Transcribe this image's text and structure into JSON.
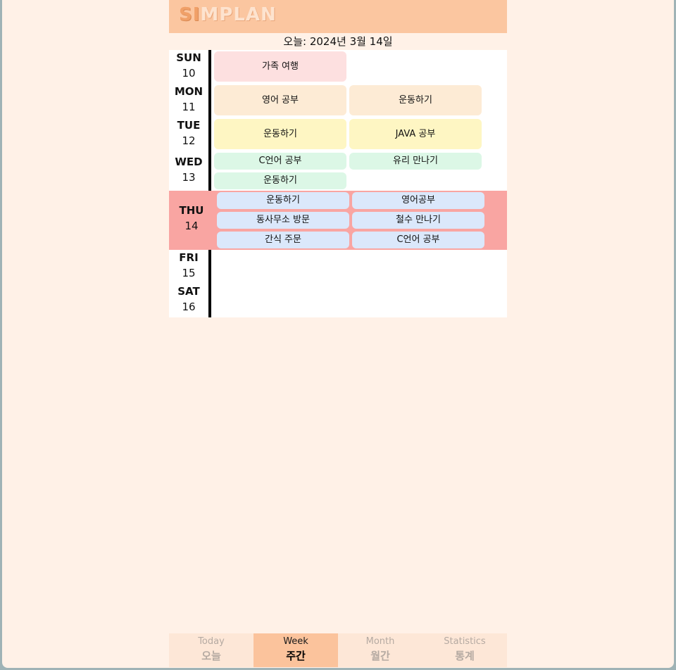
{
  "app": {
    "logo_first": "SI",
    "logo_rest": "MPLAN"
  },
  "today_label": "오늘: 2024년 3월 14일",
  "days": [
    {
      "name": "SUN",
      "num": "10",
      "events": [
        {
          "label": "가족 여행",
          "color": "#fde0e0"
        }
      ]
    },
    {
      "name": "MON",
      "num": "11",
      "events": [
        {
          "label": "영어 공부",
          "color": "#fdebd5"
        },
        {
          "label": "운동하기",
          "color": "#fdebd5"
        }
      ]
    },
    {
      "name": "TUE",
      "num": "12",
      "events": [
        {
          "label": "운동하기",
          "color": "#fef6c3"
        },
        {
          "label": "JAVA 공부",
          "color": "#fef6c3"
        }
      ]
    },
    {
      "name": "WED",
      "num": "13",
      "events": [
        {
          "label": "C언어 공부",
          "color": "#dcf7e6"
        },
        {
          "label": "유리 만나기",
          "color": "#dcf7e6"
        },
        {
          "label": "운동하기",
          "color": "#dcf7e6"
        }
      ]
    },
    {
      "name": "THU",
      "num": "14",
      "today": true,
      "events": [
        {
          "label": "운동하기",
          "color": "#dbe8fb"
        },
        {
          "label": "영어공부",
          "color": "#dbe8fb"
        },
        {
          "label": "동사무소 방문",
          "color": "#dbe8fb"
        },
        {
          "label": "철수 만나기",
          "color": "#dbe8fb"
        },
        {
          "label": "간식 주문",
          "color": "#dbe8fb"
        },
        {
          "label": "C언어 공부",
          "color": "#dbe8fb"
        }
      ]
    },
    {
      "name": "FRI",
      "num": "15",
      "events": []
    },
    {
      "name": "SAT",
      "num": "16",
      "events": []
    }
  ],
  "nav": [
    {
      "en": "Today",
      "ko": "오늘",
      "active": false
    },
    {
      "en": "Week",
      "ko": "주간",
      "active": true
    },
    {
      "en": "Month",
      "ko": "월간",
      "active": false
    },
    {
      "en": "Statistics",
      "ko": "통계",
      "active": false
    }
  ]
}
